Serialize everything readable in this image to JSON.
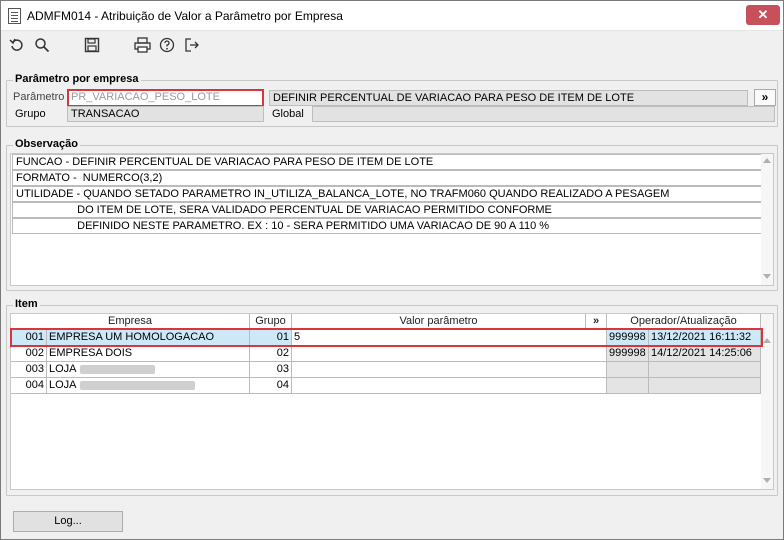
{
  "window": {
    "title": "ADMFM014 - Atribuição de Valor a Parâmetro por Empresa",
    "close_label": "✕"
  },
  "toolbar": {
    "icons": [
      "undo-icon",
      "search-icon",
      "save-icon",
      "print-icon",
      "help-icon",
      "exit-icon"
    ]
  },
  "parametro_section": {
    "title": "Parâmetro por empresa",
    "parametro_label": "Parâmetro",
    "parametro_value": "PR_VARIACAO_PESO_LOTE",
    "description": "DEFINIR PERCENTUAL DE VARIACAO PARA PESO DE ITEM DE LOTE",
    "more_label": "»",
    "grupo_label": "Grupo",
    "grupo_value": "TRANSACAO",
    "global_label": "Global",
    "global_value": ""
  },
  "observacao": {
    "title": "Observação",
    "lines": [
      "FUNCAO - DEFINIR PERCENTUAL DE VARIACAO PARA PESO DE ITEM DE LOTE",
      "FORMATO -  NUMERCO(3,2)",
      "UTILIDADE - QUANDO SETADO PARAMETRO IN_UTILIZA_BALANCA_LOTE, NO TRAFM060 QUANDO REALIZADO A PESAGEM",
      "                    DO ITEM DE LOTE, SERA VALIDADO PERCENTUAL DE VARIACAO PERMITIDO CONFORME",
      "                    DEFINIDO NESTE PARAMETRO. EX : 10 - SERA PERMITIDO UMA VARIACAO DE 90 A 110 %"
    ]
  },
  "item": {
    "title": "Item",
    "headers": {
      "empresa": "Empresa",
      "grupo": "Grupo",
      "valor": "Valor parâmetro",
      "more": "»",
      "operador": "Operador/Atualização"
    },
    "rows": [
      {
        "code": "001",
        "name": "EMPRESA UM HOMOLOGACAO",
        "grupo": "01",
        "valor": "5",
        "operador": "999998",
        "data": "13/12/2021 16:11:32"
      },
      {
        "code": "002",
        "name": "EMPRESA DOIS",
        "grupo": "02",
        "valor": "",
        "operador": "999998",
        "data": "14/12/2021 14:25:06"
      },
      {
        "code": "003",
        "name": "LOJA",
        "grupo": "03",
        "valor": "",
        "operador": "",
        "data": ""
      },
      {
        "code": "004",
        "name": "LOJA",
        "grupo": "04",
        "valor": "",
        "operador": "",
        "data": ""
      }
    ]
  },
  "footer": {
    "log_label": "Log..."
  },
  "colors": {
    "highlight_border": "#d9353d",
    "selected_row": "#cde8f6",
    "close_button": "#c7505a"
  }
}
